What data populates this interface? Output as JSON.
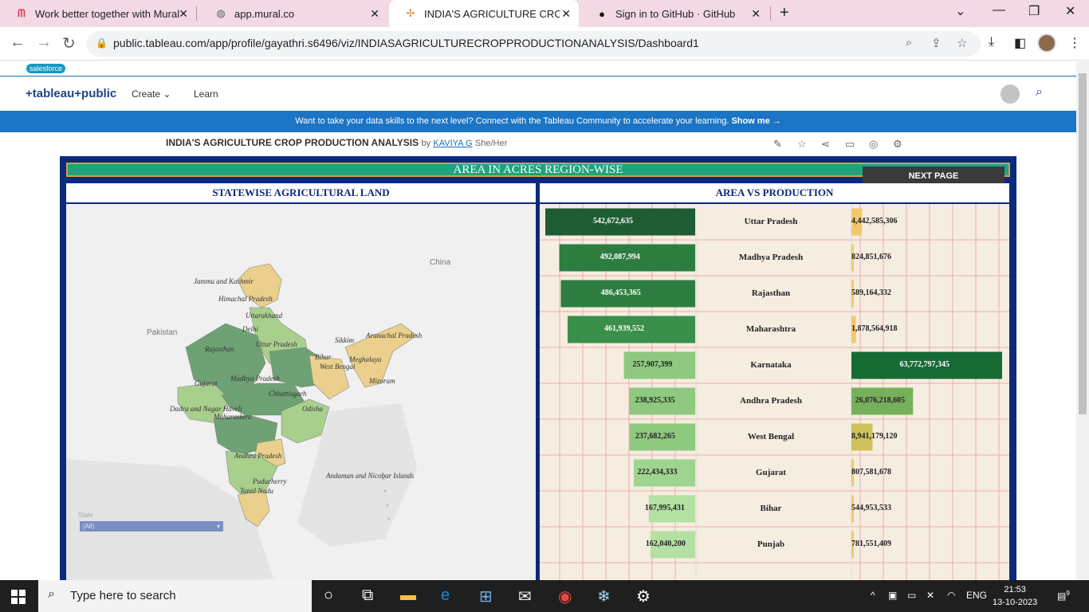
{
  "browser": {
    "tabs": [
      {
        "title": "Work better together with Mural",
        "icon": "mural-icon"
      },
      {
        "title": "app.mural.co",
        "icon": "globe-icon"
      },
      {
        "title": "INDIA'S AGRICULTURE CROP PR",
        "icon": "tableau-icon"
      },
      {
        "title": "Sign in to GitHub · GitHub",
        "icon": "github-icon"
      }
    ],
    "url": "public.tableau.com/app/profile/gayathri.s6496/viz/INDIASAGRICULTURECROPPRODUCTIONANALYSIS/Dashboard1"
  },
  "site": {
    "salesforce": "salesforce",
    "logo": "+tableau+public",
    "nav": [
      "Create",
      "Learn"
    ],
    "banner_text": "Want to take your data skills to the next level? Connect with the Tableau Community to accelerate your learning.",
    "banner_link": "Show me →"
  },
  "viz": {
    "title": "INDIA'S AGRICULTURE CROP PRODUCTION ANALYSIS",
    "by": "by",
    "author": "KAVIYA G",
    "pronoun": "She/Her"
  },
  "dashboard": {
    "title": "AREA IN ACRES REGION-WISE",
    "next_page": "NEXT PAGE",
    "map_title": "STATEWISE AGRICULTURAL LAND",
    "chart_title": "AREA VS PRODUCTION",
    "filter_label": "State",
    "filter_value": "(All)",
    "map_labels": {
      "china": "China",
      "pakistan": "Pakistan",
      "jk": "Jammu and Kashmir",
      "hp": "Himachal Pradesh",
      "uk": "Uttarakhand",
      "delhi": "Delhi",
      "up": "Uttar Pradesh",
      "sikkim": "Sikkim",
      "ap_arunachal": "Arunachal Pradesh",
      "rajasthan": "Rajasthan",
      "bihar": "Bihar",
      "meghalaya": "Meghalaya",
      "wb": "West Bengal",
      "mizoram": "Mizoram",
      "gujarat": "Gujarat",
      "mp": "Madhya Pradesh",
      "chhattisgarh": "Chhattisgarh",
      "odisha": "Odisha",
      "dnh": "Dadra and Nagar Haveli",
      "maharashtra": "Maharashtra",
      "andhra": "Andhra Pradesh",
      "andaman": "Andaman and Nicobar Islands",
      "puducherry": "Puducherry",
      "tn": "Tamil Nadu"
    }
  },
  "chart_data": {
    "type": "bar",
    "categories": [
      "Uttar Pradesh",
      "Madhya Pradesh",
      "Rajasthan",
      "Maharashtra",
      "Karnataka",
      "Andhra Pradesh",
      "West Bengal",
      "Gujarat",
      "Bihar",
      "Punjab"
    ],
    "series": [
      {
        "name": "Area",
        "values": [
          542672635,
          492087994,
          486453365,
          461939552,
          257907399,
          238925335,
          237682265,
          222434333,
          167995431,
          162040200
        ],
        "labels": [
          "542,672,635",
          "492,087,994",
          "486,453,365",
          "461,939,552",
          "257,907,399",
          "238,925,335",
          "237,682,265",
          "222,434,333",
          "167,995,431",
          "162,040,200"
        ]
      },
      {
        "name": "Production",
        "values": [
          4442585306,
          824851676,
          589164332,
          1878564918,
          63772797345,
          26076218605,
          8941179120,
          807581678,
          544953533,
          781551409
        ],
        "labels": [
          "4,442,585,306",
          "824,851,676",
          "589,164,332",
          "1,878,564,918",
          "63,772,797,345",
          "26,076,218,605",
          "8,941,179,120",
          "807,581,678",
          "544,953,533",
          "781,551,409"
        ]
      }
    ]
  },
  "taskbar": {
    "search_placeholder": "Type here to search",
    "lang": "ENG",
    "time": "21:53",
    "date": "13-10-2023",
    "notif_count": "9"
  }
}
